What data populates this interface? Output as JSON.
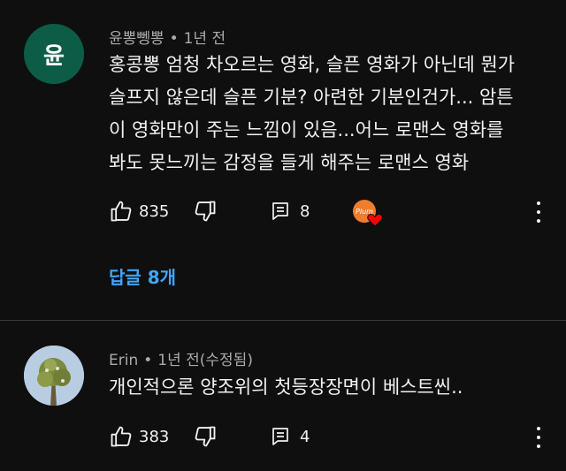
{
  "comments": [
    {
      "avatar_letter": "윤",
      "author": "윤뽕뼁뽕",
      "time": "1년 전",
      "lines": [
        "홍콩뽕 엄청 차오르는 영화, 슬픈 영화가 아닌데 뭔가",
        "슬프지 않은데 슬픈 기분? 아련한 기분인건가... 암튼",
        "이 영화만이 주는 느낌이 있음...어느 로맨스 영화를",
        "봐도 못느끼는 감정을 들게 해주는 로맨스 영화"
      ],
      "likes": "835",
      "reply_count": "8",
      "replies_link": "답글 8개",
      "creator_badge_text": "Plum"
    },
    {
      "author": "Erin",
      "time": "1년 전(수정됨)",
      "lines": [
        "개인적으론 양조위의  첫등장장면이 베스트씬.."
      ],
      "likes": "383",
      "reply_count": "4"
    }
  ],
  "icons": {
    "like": "thumbs-up-icon",
    "dislike": "thumbs-down-icon",
    "reply": "reply-comment-icon",
    "more": "more-vertical-icon",
    "heart": "creator-heart-icon"
  },
  "colors": {
    "background": "#0f0f0f",
    "text": "#f1f1f1",
    "meta": "#aaaaaa",
    "link": "#3ea6ff",
    "avatar_bg": "#0d5c48",
    "heart": "#ff0000"
  }
}
